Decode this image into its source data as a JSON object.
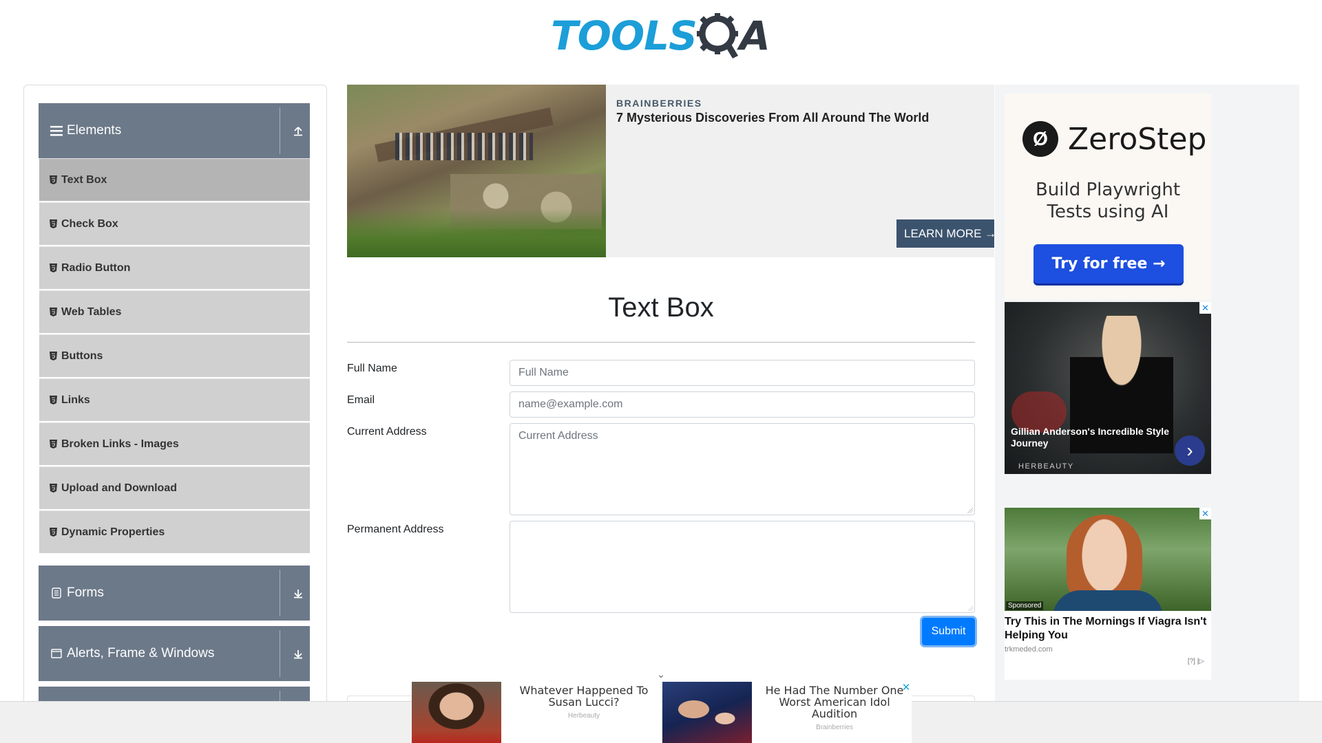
{
  "logo": {
    "tools": "TOOLS",
    "q": "Q",
    "a": "A"
  },
  "sidebar": {
    "groups": [
      {
        "label": "Elements",
        "icon": "hamburger-icon",
        "arrow": "upload-icon"
      },
      {
        "label": "Forms",
        "icon": "document-icon",
        "arrow": "download-icon"
      },
      {
        "label": "Alerts, Frame & Windows",
        "icon": "window-icon",
        "arrow": "download-icon"
      }
    ],
    "items": [
      {
        "label": "Text Box",
        "active": true
      },
      {
        "label": "Check Box"
      },
      {
        "label": "Radio Button"
      },
      {
        "label": "Web Tables"
      },
      {
        "label": "Buttons"
      },
      {
        "label": "Links"
      },
      {
        "label": "Broken Links - Images"
      },
      {
        "label": "Upload and Download"
      },
      {
        "label": "Dynamic Properties"
      }
    ]
  },
  "main_ad": {
    "sponsor": "BRAINBERRIES",
    "headline": "7 Mysterious Discoveries From All Around The World",
    "cta": "LEARN MORE →"
  },
  "form": {
    "title": "Text Box",
    "full_name_label": "Full Name",
    "full_name_placeholder": "Full Name",
    "email_label": "Email",
    "email_placeholder": "name@example.com",
    "current_address_label": "Current Address",
    "current_address_placeholder": "Current Address",
    "permanent_address_label": "Permanent Address",
    "permanent_address_placeholder": "",
    "submit_label": "Submit"
  },
  "right_ads": {
    "zerostep": {
      "logo_glyph": "Ø",
      "name": "ZeroStep",
      "tagline_1": "Build Playwright",
      "tagline_2": "Tests using AI",
      "button": "Try for free →"
    },
    "card1": {
      "caption": "Gillian Anderson's Incredible Style Journey",
      "brand": "HERBEAUTY",
      "next": "›",
      "close": "✕"
    },
    "card2": {
      "sponsored": "Sponsored",
      "headline": "Try This in The Mornings If Viagra Isn't Helping You",
      "domain": "trkmeded.com",
      "adchoices": "[?] |▷",
      "close": "✕"
    }
  },
  "bottom_ads": {
    "collapse": "⌄",
    "ad1": {
      "title": "Whatever Happened To Susan Lucci?",
      "source": "Herbeauty"
    },
    "ad2": {
      "title": "He Had The Number One Worst American Idol Audition",
      "source": "Brainberries",
      "close": "✕"
    }
  },
  "colors": {
    "sidebar_header": "#6c7989",
    "sidebar_item": "#d0d0d0",
    "sidebar_item_active": "#b4b4b4",
    "submit": "#007bff",
    "logo_blue": "#1c9ed8",
    "zerostep_button": "#1d4fe0"
  }
}
